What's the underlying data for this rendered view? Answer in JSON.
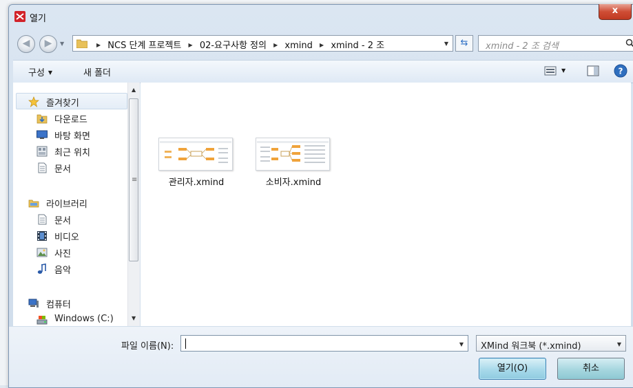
{
  "window": {
    "title": "열기",
    "close_label": "x"
  },
  "address": {
    "crumbs": [
      "NCS 단계 프로젝트",
      "02-요구사항 정의",
      "xmind",
      "xmind - 2 조"
    ],
    "search_placeholder": "xmind - 2 조 검색"
  },
  "toolbar": {
    "organize_label": "구성",
    "new_folder_label": "새 폴더"
  },
  "sidebar": {
    "favorites": {
      "label": "즐겨찾기",
      "items": [
        {
          "label": "다운로드",
          "icon": "downloads-icon"
        },
        {
          "label": "바탕 화면",
          "icon": "desktop-icon"
        },
        {
          "label": "최근 위치",
          "icon": "recent-places-icon"
        },
        {
          "label": "문서",
          "icon": "document-icon"
        }
      ]
    },
    "libraries": {
      "label": "라이브러리",
      "items": [
        {
          "label": "문서",
          "icon": "document-icon"
        },
        {
          "label": "비디오",
          "icon": "video-icon"
        },
        {
          "label": "사진",
          "icon": "pictures-icon"
        },
        {
          "label": "음악",
          "icon": "music-icon"
        }
      ]
    },
    "computer": {
      "label": "컴퓨터",
      "items": [
        {
          "label": "Windows (C:)",
          "icon": "drive-icon"
        }
      ]
    }
  },
  "files": [
    {
      "name": "관리자.xmind"
    },
    {
      "name": "소비자.xmind"
    }
  ],
  "footer": {
    "filename_label": "파일 이름(N):",
    "filename_value": "",
    "filetype_value": "XMind 워크북 (*.xmind)",
    "open_label": "열기(O)",
    "cancel_label": "취소"
  },
  "colors": {
    "accent": "#3c7fb1",
    "close_button": "#c9452d",
    "app_icon": "#d2232a"
  }
}
